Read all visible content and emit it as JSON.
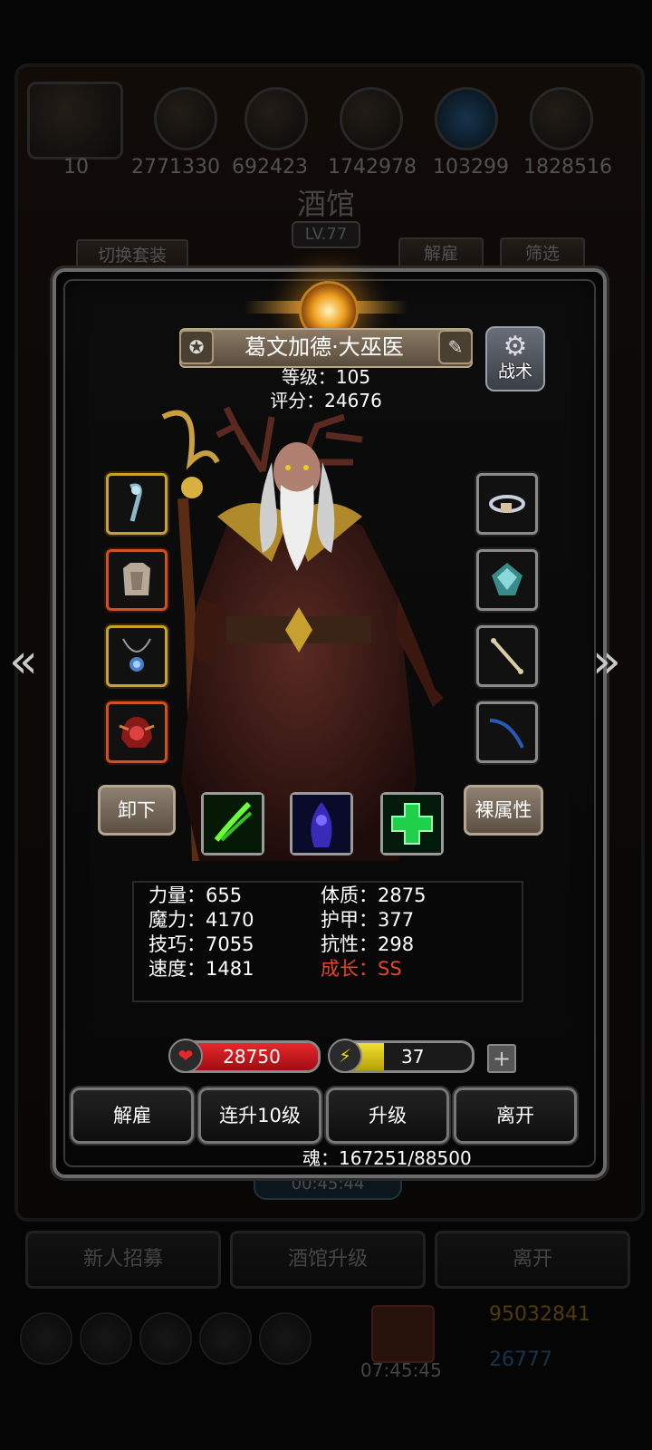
{
  "background": {
    "resource_values": [
      "10",
      "2771330",
      "692423",
      "1742978",
      "103299",
      "1828516"
    ],
    "title": "酒馆",
    "level": "LV.77",
    "switch_outfit_label": "切换套装",
    "dismiss_label": "解雇",
    "filter_label": "筛选",
    "timer": "00:45:44",
    "recruit_label": "新人招募",
    "upgrade_tavern_label": "酒馆升级",
    "leave_label": "离开",
    "gold": "95032841",
    "gems": "26777",
    "chest_timer": "07:45:45"
  },
  "hero": {
    "name": "葛文加德·大巫医",
    "level_line": "等级：105",
    "score_line": "评分：24676",
    "tactics_label": "战术"
  },
  "equipment": {
    "left": [
      "staff",
      "chest-armor",
      "amulet",
      "helmet"
    ],
    "right": [
      "bracelet",
      "gem",
      "bone",
      "bow"
    ]
  },
  "buttons": {
    "unequip": "卸下",
    "base_attrs": "裸属性",
    "dismiss": "解雇",
    "level_up_10": "连升10级",
    "level_up": "升级",
    "leave": "离开"
  },
  "skills": [
    "green-claw-skill",
    "blue-shadow-skill",
    "heal-cross-skill"
  ],
  "attributes": {
    "strength": "力量：655",
    "magic": "魔力：4170",
    "skill": "技巧：7055",
    "speed": "速度：1481",
    "constitution": "体质：2875",
    "armor": "护甲：377",
    "resistance": "抗性：298",
    "growth": "成长：SS"
  },
  "bars": {
    "hp": "28750",
    "hp_fill": 1.0,
    "energy": "37",
    "energy_fill": 0.37
  },
  "soul": "魂：167251/88500",
  "colors": {
    "hp": "#c8141c",
    "energy": "#d8c010",
    "growth": "#e8442c"
  }
}
